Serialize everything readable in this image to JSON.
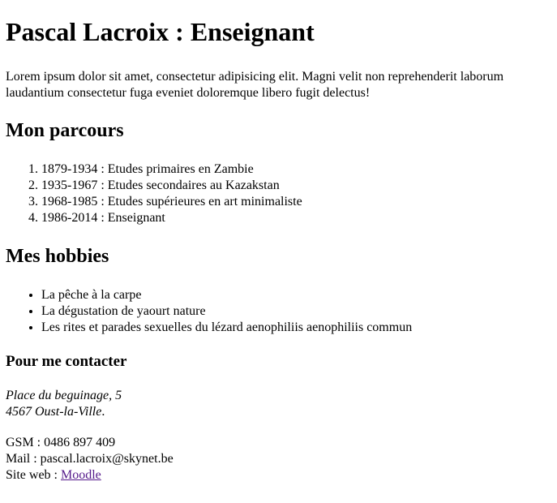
{
  "title": "Pascal Lacroix : Enseignant",
  "intro": "Lorem ipsum dolor sit amet, consectetur adipisicing elit. Magni velit non reprehenderit laborum laudantium consectetur fuga eveniet doloremque libero fugit delectus!",
  "parcours": {
    "heading": "Mon parcours",
    "items": [
      "1879-1934 : Etudes primaires en Zambie",
      "1935-1967 : Etudes secondaires au Kazakstan",
      "1968-1985 : Etudes supérieures en art minimaliste",
      "1986-2014 : Enseignant"
    ]
  },
  "hobbies": {
    "heading": "Mes hobbies",
    "items": [
      "La pêche à la carpe",
      "La dégustation de yaourt nature",
      "Les rites et parades sexuelles du lézard aenophiliis aenophiliis commun"
    ]
  },
  "contact": {
    "heading": "Pour me contacter",
    "address_line1": "Place du beguinage, 5",
    "address_line2": "4567 Oust-la-Ville",
    "address_end": ".",
    "gsm": "GSM : 0486 897 409",
    "mail": "Mail : pascal.lacroix@skynet.be",
    "site_label": "Site web : ",
    "site_link": "Moodle"
  },
  "colors": {
    "link": "#551a8b"
  }
}
